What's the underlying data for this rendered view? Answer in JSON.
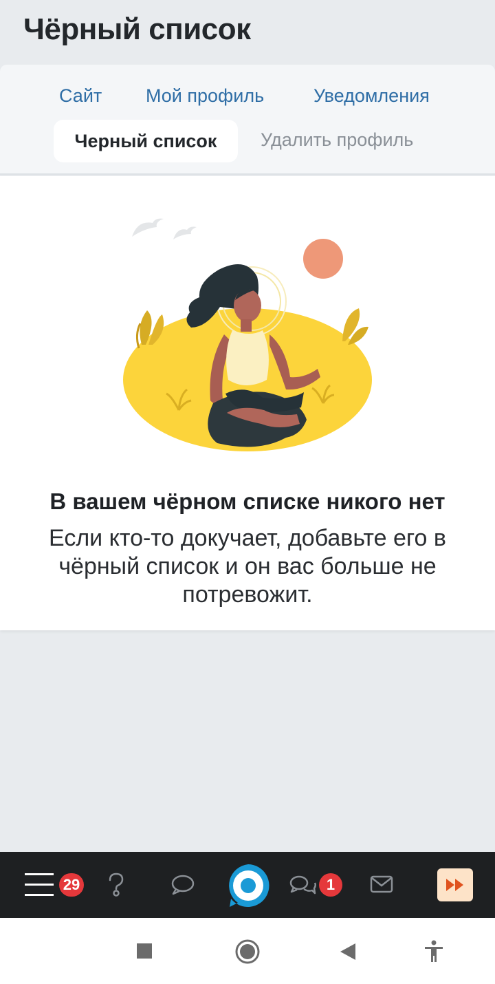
{
  "header": {
    "title": "Чёрный список"
  },
  "tabs": [
    {
      "label": "Сайт",
      "state": "link"
    },
    {
      "label": "Мой профиль",
      "state": "link"
    },
    {
      "label": "Уведомления",
      "state": "link"
    },
    {
      "label": "Черный список",
      "state": "active"
    },
    {
      "label": "Удалить профиль",
      "state": "muted"
    }
  ],
  "empty_state": {
    "title": "В вашем чёрном списке никого нет",
    "text": "Если кто-то докучает, добавьте его в чёрный список и он вас больше не потревожит."
  },
  "bottom_nav": {
    "menu_badge": "29",
    "chats_badge": "1",
    "icons": [
      "menu-icon",
      "help-icon",
      "comment-icon",
      "app-logo-icon",
      "chats-icon",
      "mail-icon",
      "fast-forward-icon"
    ]
  },
  "system_nav": {
    "icons": [
      "recent-apps-icon",
      "home-icon",
      "back-icon",
      "accessibility-icon"
    ]
  },
  "colors": {
    "link": "#2f6ea6",
    "muted": "#8a9097",
    "badge": "#e5383b",
    "nav_bg": "#1e2022",
    "accent_logo": "#1a9ad6",
    "forward_button": "#fde3c8"
  }
}
